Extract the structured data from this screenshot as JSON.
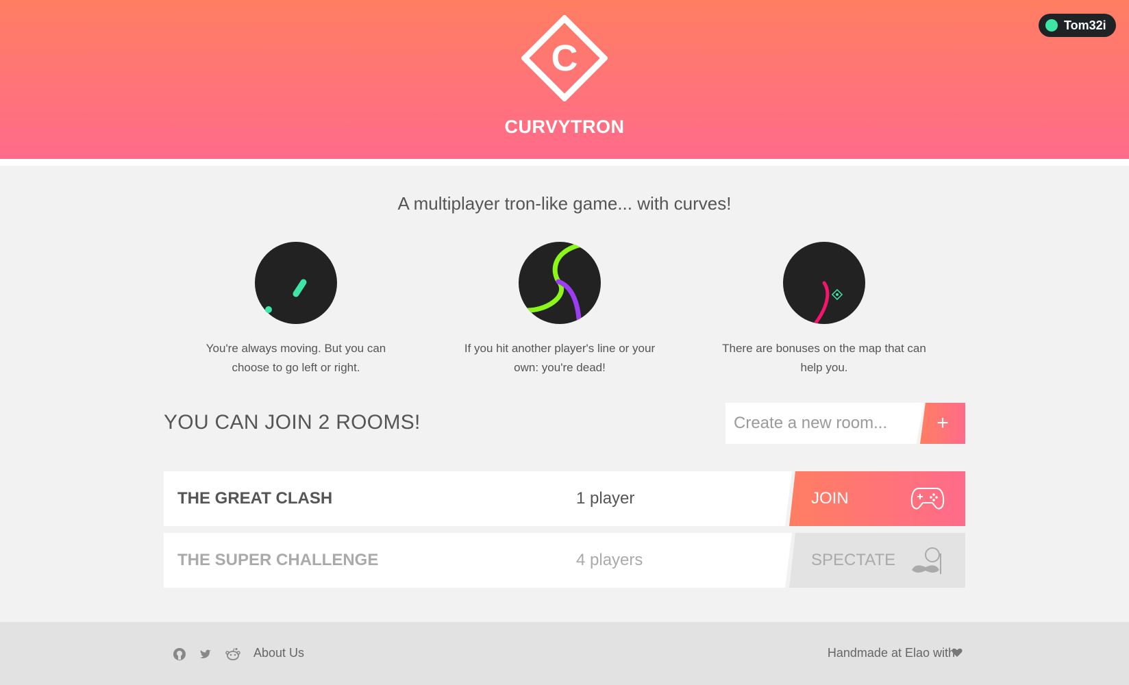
{
  "header": {
    "logo_letter": "C",
    "brand": "CURVYTRON",
    "user": {
      "name": "Tom32i",
      "status_color": "#3ee6a6"
    }
  },
  "intro": {
    "tagline": "A multiplayer tron-like game... with curves!",
    "features": [
      {
        "icon": "moving-line-icon",
        "text": "You're always moving. But you can choose to go left or right."
      },
      {
        "icon": "crossing-lines-icon",
        "text": "If you hit another player's line or your own: you're dead!"
      },
      {
        "icon": "bonus-icon",
        "text": "There are bonuses on the map that can help you."
      }
    ]
  },
  "rooms": {
    "title": "YOU CAN JOIN 2 ROOMS!",
    "create_placeholder": "Create a new room...",
    "add_label": "+",
    "list": [
      {
        "name": "THE GREAT CLASH",
        "players": "1 player",
        "action": "JOIN",
        "icon": "gamepad-icon"
      },
      {
        "name": "THE SUPER CHALLENGE",
        "players": "4 players",
        "action": "SPECTATE",
        "icon": "spectator-mustache-icon"
      }
    ]
  },
  "footer": {
    "links": [
      "github-icon",
      "twitter-icon",
      "reddit-icon"
    ],
    "about": "About Us",
    "handmade": "Handmade at Elao with"
  },
  "colors": {
    "accent_start": "#ff7e62",
    "accent_end": "#ff6b8a",
    "dark": "#222222"
  }
}
